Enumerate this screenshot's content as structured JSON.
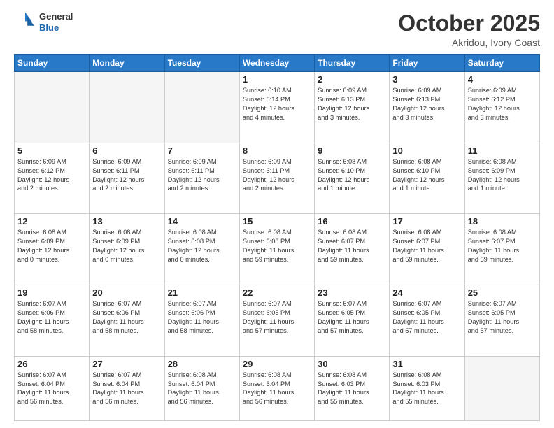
{
  "header": {
    "logo_general": "General",
    "logo_blue": "Blue",
    "month": "October 2025",
    "location": "Akridou, Ivory Coast"
  },
  "weekdays": [
    "Sunday",
    "Monday",
    "Tuesday",
    "Wednesday",
    "Thursday",
    "Friday",
    "Saturday"
  ],
  "weeks": [
    [
      {
        "day": "",
        "info": ""
      },
      {
        "day": "",
        "info": ""
      },
      {
        "day": "",
        "info": ""
      },
      {
        "day": "1",
        "info": "Sunrise: 6:10 AM\nSunset: 6:14 PM\nDaylight: 12 hours\nand 4 minutes."
      },
      {
        "day": "2",
        "info": "Sunrise: 6:09 AM\nSunset: 6:13 PM\nDaylight: 12 hours\nand 3 minutes."
      },
      {
        "day": "3",
        "info": "Sunrise: 6:09 AM\nSunset: 6:13 PM\nDaylight: 12 hours\nand 3 minutes."
      },
      {
        "day": "4",
        "info": "Sunrise: 6:09 AM\nSunset: 6:12 PM\nDaylight: 12 hours\nand 3 minutes."
      }
    ],
    [
      {
        "day": "5",
        "info": "Sunrise: 6:09 AM\nSunset: 6:12 PM\nDaylight: 12 hours\nand 2 minutes."
      },
      {
        "day": "6",
        "info": "Sunrise: 6:09 AM\nSunset: 6:11 PM\nDaylight: 12 hours\nand 2 minutes."
      },
      {
        "day": "7",
        "info": "Sunrise: 6:09 AM\nSunset: 6:11 PM\nDaylight: 12 hours\nand 2 minutes."
      },
      {
        "day": "8",
        "info": "Sunrise: 6:09 AM\nSunset: 6:11 PM\nDaylight: 12 hours\nand 2 minutes."
      },
      {
        "day": "9",
        "info": "Sunrise: 6:08 AM\nSunset: 6:10 PM\nDaylight: 12 hours\nand 1 minute."
      },
      {
        "day": "10",
        "info": "Sunrise: 6:08 AM\nSunset: 6:10 PM\nDaylight: 12 hours\nand 1 minute."
      },
      {
        "day": "11",
        "info": "Sunrise: 6:08 AM\nSunset: 6:09 PM\nDaylight: 12 hours\nand 1 minute."
      }
    ],
    [
      {
        "day": "12",
        "info": "Sunrise: 6:08 AM\nSunset: 6:09 PM\nDaylight: 12 hours\nand 0 minutes."
      },
      {
        "day": "13",
        "info": "Sunrise: 6:08 AM\nSunset: 6:09 PM\nDaylight: 12 hours\nand 0 minutes."
      },
      {
        "day": "14",
        "info": "Sunrise: 6:08 AM\nSunset: 6:08 PM\nDaylight: 12 hours\nand 0 minutes."
      },
      {
        "day": "15",
        "info": "Sunrise: 6:08 AM\nSunset: 6:08 PM\nDaylight: 11 hours\nand 59 minutes."
      },
      {
        "day": "16",
        "info": "Sunrise: 6:08 AM\nSunset: 6:07 PM\nDaylight: 11 hours\nand 59 minutes."
      },
      {
        "day": "17",
        "info": "Sunrise: 6:08 AM\nSunset: 6:07 PM\nDaylight: 11 hours\nand 59 minutes."
      },
      {
        "day": "18",
        "info": "Sunrise: 6:08 AM\nSunset: 6:07 PM\nDaylight: 11 hours\nand 59 minutes."
      }
    ],
    [
      {
        "day": "19",
        "info": "Sunrise: 6:07 AM\nSunset: 6:06 PM\nDaylight: 11 hours\nand 58 minutes."
      },
      {
        "day": "20",
        "info": "Sunrise: 6:07 AM\nSunset: 6:06 PM\nDaylight: 11 hours\nand 58 minutes."
      },
      {
        "day": "21",
        "info": "Sunrise: 6:07 AM\nSunset: 6:06 PM\nDaylight: 11 hours\nand 58 minutes."
      },
      {
        "day": "22",
        "info": "Sunrise: 6:07 AM\nSunset: 6:05 PM\nDaylight: 11 hours\nand 57 minutes."
      },
      {
        "day": "23",
        "info": "Sunrise: 6:07 AM\nSunset: 6:05 PM\nDaylight: 11 hours\nand 57 minutes."
      },
      {
        "day": "24",
        "info": "Sunrise: 6:07 AM\nSunset: 6:05 PM\nDaylight: 11 hours\nand 57 minutes."
      },
      {
        "day": "25",
        "info": "Sunrise: 6:07 AM\nSunset: 6:05 PM\nDaylight: 11 hours\nand 57 minutes."
      }
    ],
    [
      {
        "day": "26",
        "info": "Sunrise: 6:07 AM\nSunset: 6:04 PM\nDaylight: 11 hours\nand 56 minutes."
      },
      {
        "day": "27",
        "info": "Sunrise: 6:07 AM\nSunset: 6:04 PM\nDaylight: 11 hours\nand 56 minutes."
      },
      {
        "day": "28",
        "info": "Sunrise: 6:08 AM\nSunset: 6:04 PM\nDaylight: 11 hours\nand 56 minutes."
      },
      {
        "day": "29",
        "info": "Sunrise: 6:08 AM\nSunset: 6:04 PM\nDaylight: 11 hours\nand 56 minutes."
      },
      {
        "day": "30",
        "info": "Sunrise: 6:08 AM\nSunset: 6:03 PM\nDaylight: 11 hours\nand 55 minutes."
      },
      {
        "day": "31",
        "info": "Sunrise: 6:08 AM\nSunset: 6:03 PM\nDaylight: 11 hours\nand 55 minutes."
      },
      {
        "day": "",
        "info": ""
      }
    ]
  ]
}
